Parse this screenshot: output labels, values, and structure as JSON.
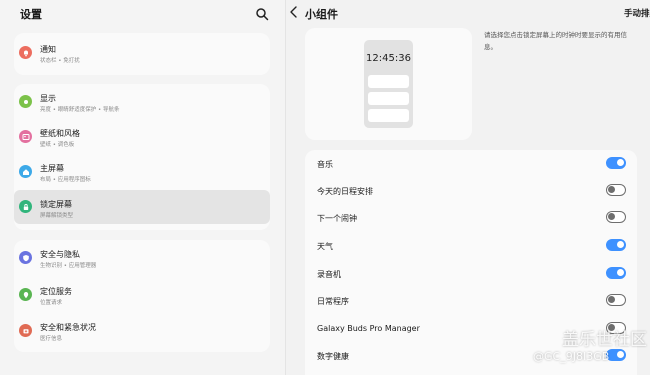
{
  "settings": {
    "title": "设置",
    "groups": [
      {
        "items": [
          {
            "label": "通知",
            "sub": "状态栏 • 免打扰",
            "icon": "bell-icon",
            "color": "#ec6d5f"
          }
        ]
      },
      {
        "items": [
          {
            "label": "显示",
            "sub": "亮度 • 眼睛舒适度保护 • 导航条",
            "icon": "sun-icon",
            "color": "#7cc24a"
          },
          {
            "label": "壁纸和风格",
            "sub": "壁纸 • 调色板",
            "icon": "image-icon",
            "color": "#e3709f"
          },
          {
            "label": "主屏幕",
            "sub": "布局 • 应用程序图标",
            "icon": "home-icon",
            "color": "#3da9e8"
          },
          {
            "label": "锁定屏幕",
            "sub": "屏幕解锁类型",
            "icon": "lock-icon",
            "color": "#31b57c",
            "selected": true
          }
        ]
      },
      {
        "items": [
          {
            "label": "安全与隐私",
            "sub": "生物识别 • 应用管理器",
            "icon": "shield-icon",
            "color": "#6a73e0"
          },
          {
            "label": "定位服务",
            "sub": "位置请求",
            "icon": "location-pin-icon",
            "color": "#5ab552"
          },
          {
            "label": "安全和紧急状况",
            "sub": "医疗信息",
            "icon": "emergency-icon",
            "color": "#e06b54"
          }
        ]
      }
    ]
  },
  "widgets": {
    "title": "小组件",
    "manual_sort": "手动排序",
    "preview_time": "12:45:36",
    "description": "请选择您点击锁定屏幕上的时钟时要显示的有用信息。",
    "items": [
      {
        "label": "音乐",
        "on": true
      },
      {
        "label": "今天的日程安排",
        "on": false
      },
      {
        "label": "下一个闹钟",
        "on": false
      },
      {
        "label": "天气",
        "on": true
      },
      {
        "label": "录音机",
        "on": true
      },
      {
        "label": "日常程序",
        "on": false
      },
      {
        "label": "Galaxy Buds Pro Manager",
        "on": false
      },
      {
        "label": "数字健康",
        "on": true
      }
    ]
  },
  "watermark": {
    "line1": "盖乐世社区",
    "line2": "@GC_9J8I3GB"
  },
  "accent_color": "#3e91ff"
}
